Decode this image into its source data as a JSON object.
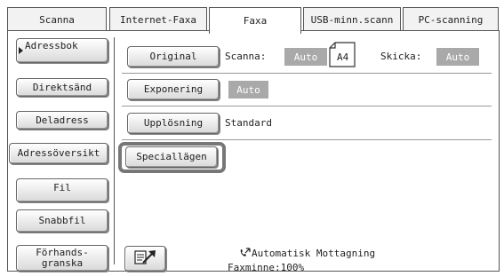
{
  "tabs": [
    {
      "label": "Scanna"
    },
    {
      "label": "Internet-Faxa"
    },
    {
      "label": "Faxa"
    },
    {
      "label": "USB-minn.scann"
    },
    {
      "label": "PC-scanning"
    }
  ],
  "active_tab": "Faxa",
  "sidebar": {
    "items": [
      {
        "label": "Adressbok"
      },
      {
        "label": "Direktsänd"
      },
      {
        "label": "Deladress"
      },
      {
        "label": "Adressöversikt"
      },
      {
        "label": "Fil"
      },
      {
        "label": "Snabbfil"
      },
      {
        "label": "Förhands-\ngranska"
      }
    ]
  },
  "settings": {
    "original_label": "Original",
    "scan_label": "Scanna:",
    "scan_value": "Auto",
    "paper_size": "A4",
    "send_label": "Skicka:",
    "send_value": "Auto",
    "exposure_label": "Exponering",
    "exposure_value": "Auto",
    "resolution_label": "Upplösning",
    "resolution_value": "Standard",
    "special_label": "Speciallägen"
  },
  "status": {
    "auto_receive": "Automatisk Mottagning",
    "fax_memory": "Faxminne:100%"
  },
  "colors": {
    "badge": "#a9a9a9",
    "highlight_border": "#777777"
  },
  "icons": {
    "arrow_icon": "arrow-pointer-icon",
    "phone_icon": "phone-receive-icon",
    "paper_icon": "paper-icon"
  }
}
